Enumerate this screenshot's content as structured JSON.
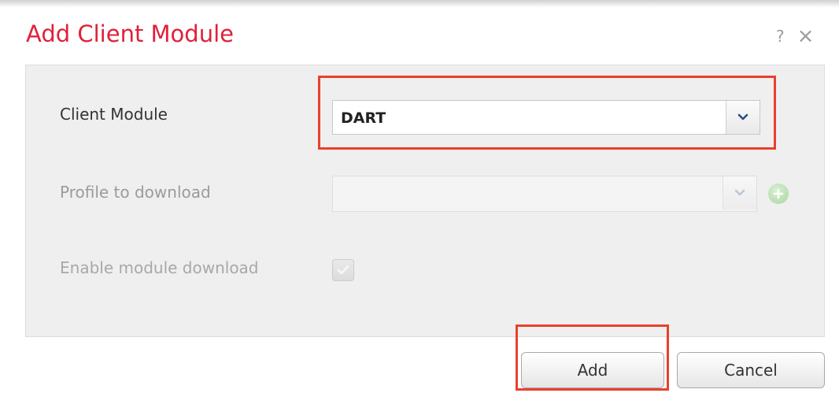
{
  "dialog": {
    "title": "Add Client Module",
    "help_glyph": "?",
    "close_glyph": "×"
  },
  "form": {
    "client_module": {
      "label": "Client Module",
      "value": "DART"
    },
    "profile": {
      "label": "Profile to download",
      "value": ""
    },
    "enable_download": {
      "label": "Enable module download",
      "checked": true
    }
  },
  "buttons": {
    "add": "Add",
    "cancel": "Cancel"
  },
  "colors": {
    "title": "#e0203a",
    "highlight": "#e8402e",
    "panel_bg": "#efefef"
  },
  "icons": [
    "help-icon",
    "close-icon",
    "chevron-down-icon",
    "plus-circle-icon",
    "checkmark-icon"
  ]
}
